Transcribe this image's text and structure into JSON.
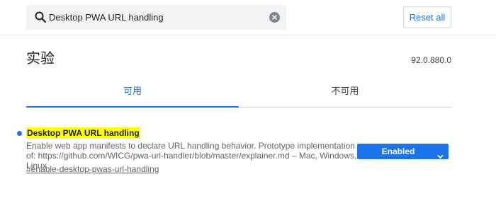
{
  "search": {
    "value": "Desktop PWA URL handling",
    "icon": "search-icon",
    "clear_icon": "clear-icon"
  },
  "header": {
    "reset_label": "Reset all"
  },
  "page": {
    "title": "实验",
    "version": "92.0.880.0"
  },
  "tabs": [
    {
      "label": "可用",
      "active": true
    },
    {
      "label": "不可用",
      "active": false
    }
  ],
  "experiment": {
    "name": "Desktop PWA URL handling",
    "description": "Enable web app manifests to declare URL handling behavior. Prototype implementation of: https://github.com/WICG/pwa-url-handler/blob/master/explainer.md – Mac, Windows, Linux",
    "anchor": "#enable-desktop-pwas-url-handling",
    "selected_option": "Enabled"
  },
  "colors": {
    "accent": "#1a73e8",
    "highlight": "#ffff00",
    "search_bg": "#f1f3f4"
  }
}
